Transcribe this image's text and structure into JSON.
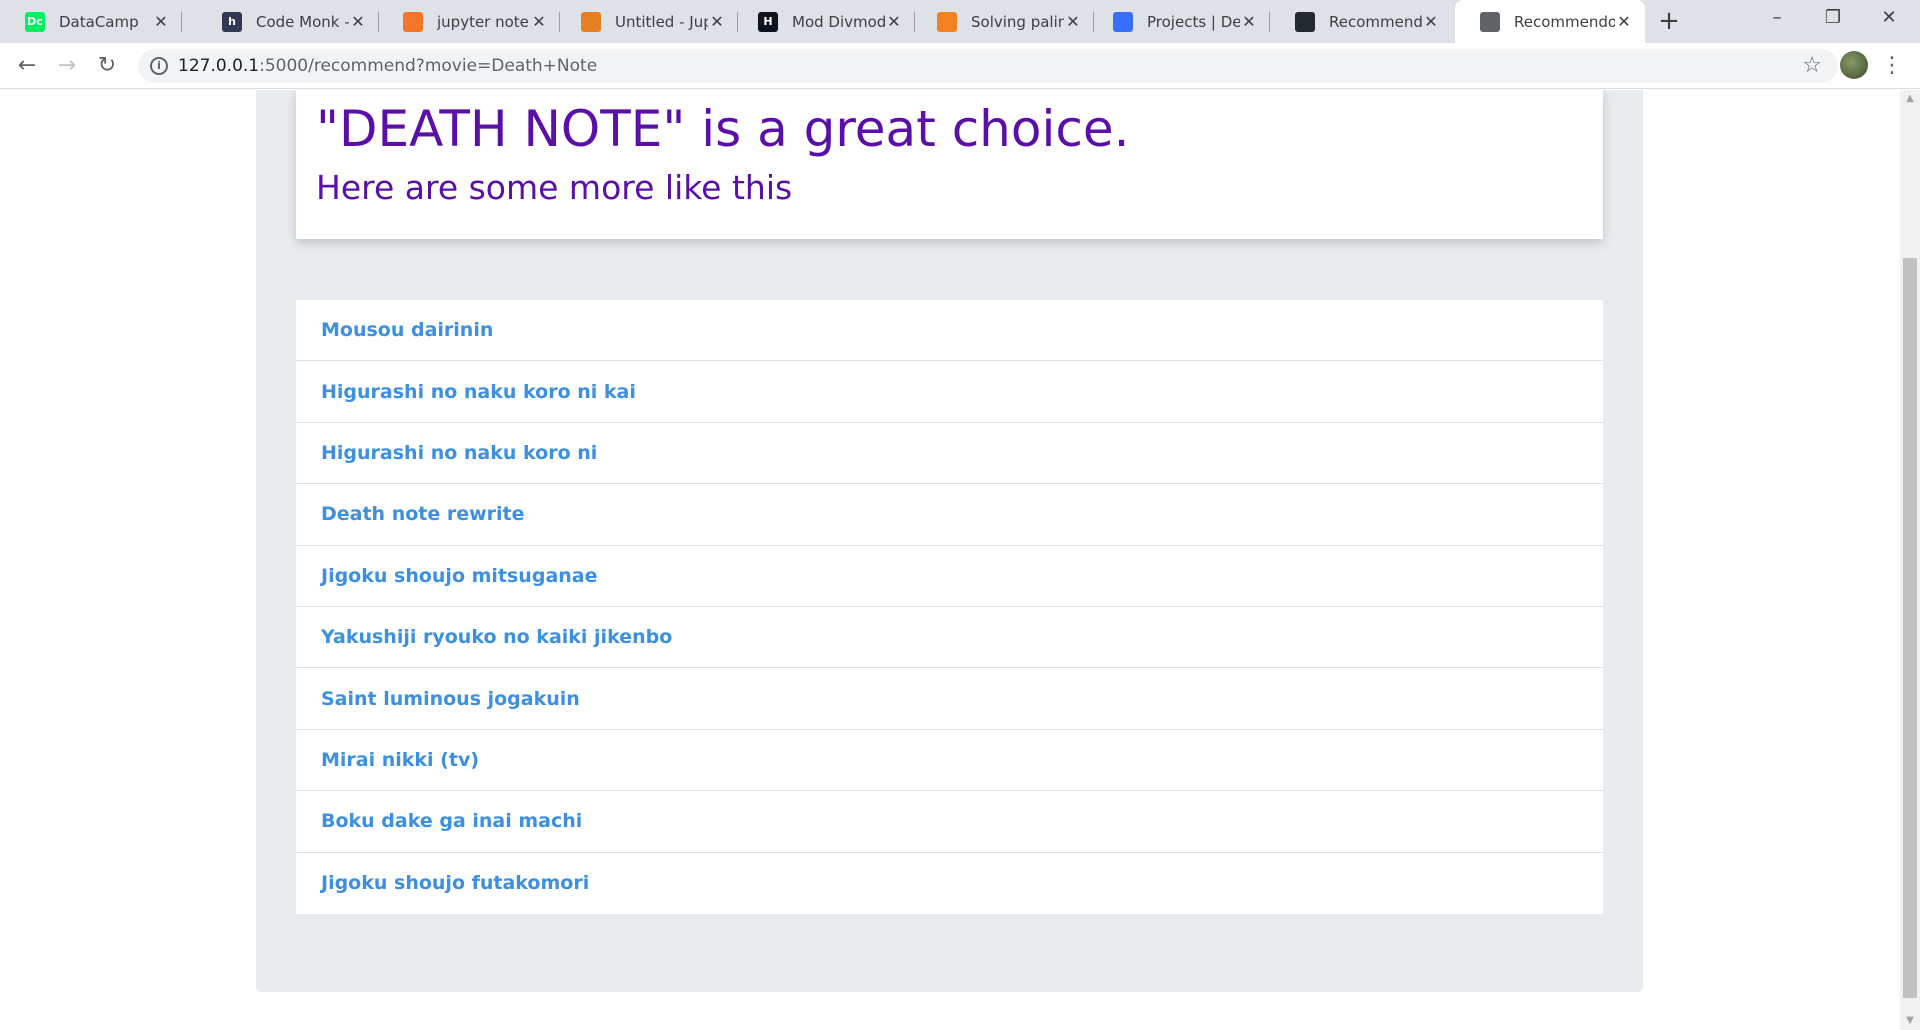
{
  "browser": {
    "tabs": [
      {
        "title": "DataCamp",
        "icon": "datacamp-icon",
        "color": "#03ef62",
        "glyph": "Dc"
      },
      {
        "title": "Code Monk - B",
        "icon": "hackerearth-icon",
        "color": "#323754",
        "glyph": "h"
      },
      {
        "title": "jupyter notebo",
        "icon": "jupyter-icon",
        "color": "#f37726",
        "glyph": ""
      },
      {
        "title": "Untitled - Jupy",
        "icon": "notebook-icon",
        "color": "#e67e22",
        "glyph": ""
      },
      {
        "title": "Mod Divmod | [",
        "icon": "hackerrank-icon",
        "color": "#0e141e",
        "glyph": "H"
      },
      {
        "title": "Solving palindr",
        "icon": "stackoverflow-icon",
        "color": "#f48024",
        "glyph": ""
      },
      {
        "title": "Projects | Devfo",
        "icon": "devfolio-icon",
        "color": "#3770ff",
        "glyph": ""
      },
      {
        "title": "Recommendati",
        "icon": "github-icon",
        "color": "#24292e",
        "glyph": ""
      },
      {
        "title": "Recommendor",
        "icon": "globe-icon",
        "color": "#5f6368",
        "glyph": "",
        "active": true
      }
    ],
    "url_host": "127.0.0.1",
    "url_rest": ":5000/recommend?movie=Death+Note"
  },
  "page": {
    "heading": "\"DEATH NOTE\" is a great choice.",
    "subheading": "Here are some more like this",
    "recommendations": [
      "Mousou dairinin",
      "Higurashi no naku koro ni kai",
      "Higurashi no naku koro ni",
      "Death note rewrite",
      "Jigoku shoujo mitsuganae",
      "Yakushiji ryouko no kaiki jikenbo",
      "Saint luminous jogakuin",
      "Mirai nikki (tv)",
      "Boku dake ga inai machi",
      "Jigoku shoujo futakomori"
    ]
  }
}
